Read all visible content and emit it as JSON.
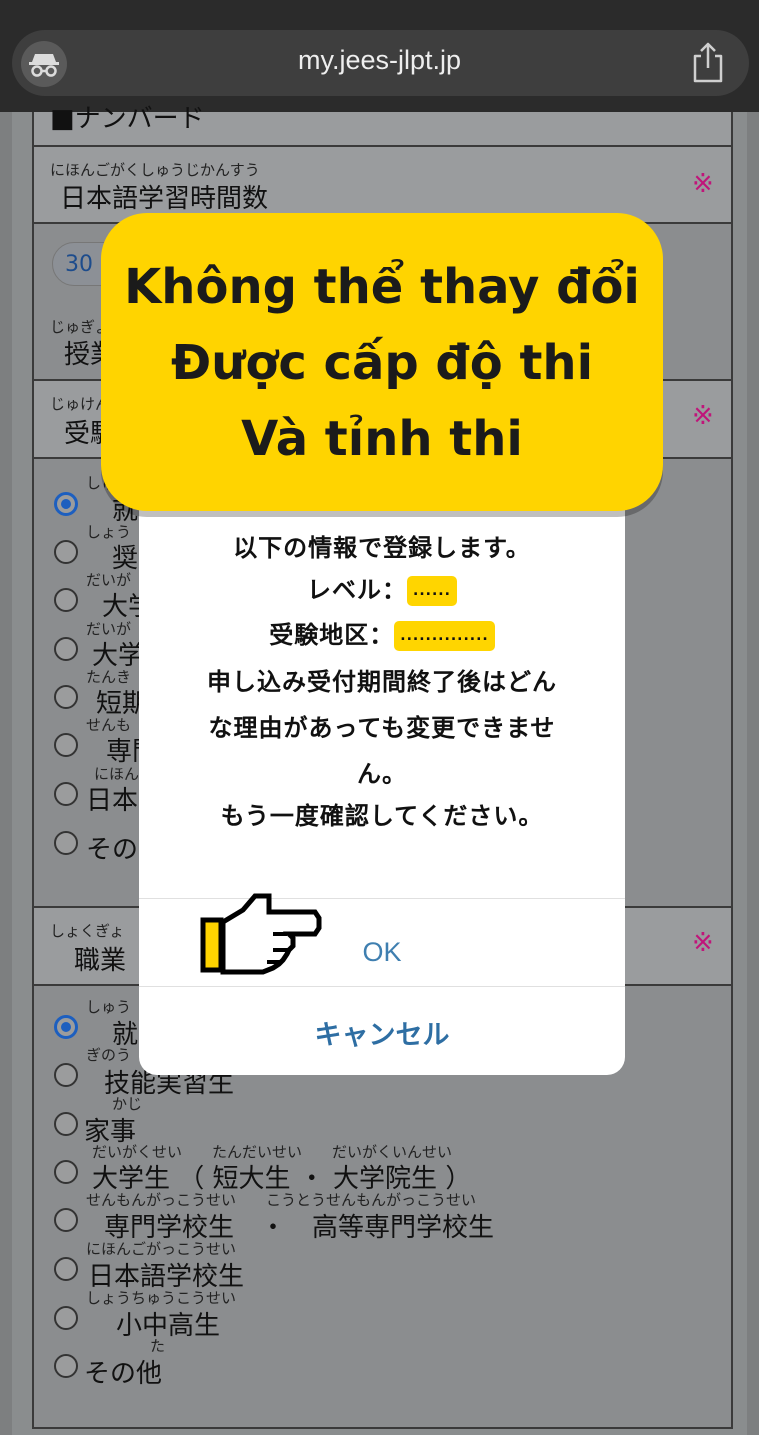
{
  "browser": {
    "url": "my.jees-jlpt.jp"
  },
  "form": {
    "top_partial_label": "■ナンバード",
    "study_hours": {
      "ruby": "にほんごがくしゅうじかんすう",
      "label": "日本語学習時間数",
      "required": "※",
      "value": "30"
    },
    "class_hours": {
      "ruby": "じゅぎょう",
      "label": "授業"
    },
    "exam_purpose": {
      "ruby": "じゅけん",
      "label": "受験",
      "required": "※",
      "options": [
        {
          "ruby": "しゅう",
          "label": "就",
          "selected": true
        },
        {
          "ruby": "しょう",
          "label": "奨",
          "selected": false
        },
        {
          "ruby": "だいが",
          "label": "大学",
          "selected": false
        },
        {
          "ruby": "だいが",
          "label": "大学",
          "selected": false
        },
        {
          "ruby": "たんき",
          "label": "短期",
          "selected": false
        },
        {
          "ruby": "せんも",
          "label": "専門",
          "selected": false
        },
        {
          "ruby": "にほん",
          "label": "日本",
          "selected": false
        },
        {
          "ruby": "",
          "label": "その",
          "selected": false
        }
      ]
    },
    "occupation": {
      "ruby": "しょくぎょ",
      "label": "職業",
      "required": "※",
      "options": [
        {
          "ruby": "しゅう",
          "label": "就",
          "selected": true
        },
        {
          "ruby": "ぎのう",
          "label": "技能実習生",
          "selected": false
        },
        {
          "ruby": "かじ",
          "label": "家事",
          "selected": false
        },
        {
          "ruby": "だいがくせい　　たんだいせい　　だいがくいんせい",
          "label": "大学生 （ 短大生 ・ 大学院生 ）",
          "selected": false
        },
        {
          "ruby": "せんもんがっこうせい　　こうとうせんもんがっこうせい",
          "label": "専門学校生　・　高等専門学校生",
          "selected": false
        },
        {
          "ruby": "にほんごがっこうせい",
          "label": "日本語学校生",
          "selected": false
        },
        {
          "ruby": "しょうちゅうこうせい",
          "label": "小中高生",
          "selected": false
        },
        {
          "ruby": "た",
          "label": "その他",
          "selected": false
        }
      ]
    }
  },
  "dialog": {
    "line1": "以下の情報で登録します。",
    "level_label": "レベル：",
    "level_value": "......",
    "area_label": "受験地区：",
    "area_value": "..............",
    "line4": "申し込み受付期間終了後はどん",
    "line5": "な理由があっても変更できませ",
    "line6": "ん。",
    "line7": "もう一度確認してください。",
    "ok_label": "OK",
    "cancel_label": "キャンセル"
  },
  "banner": {
    "line1": "Không thể thay đổi",
    "line2": "Được cấp độ thi",
    "line3": "Và tỉnh thi",
    "color": "#ffd400"
  }
}
